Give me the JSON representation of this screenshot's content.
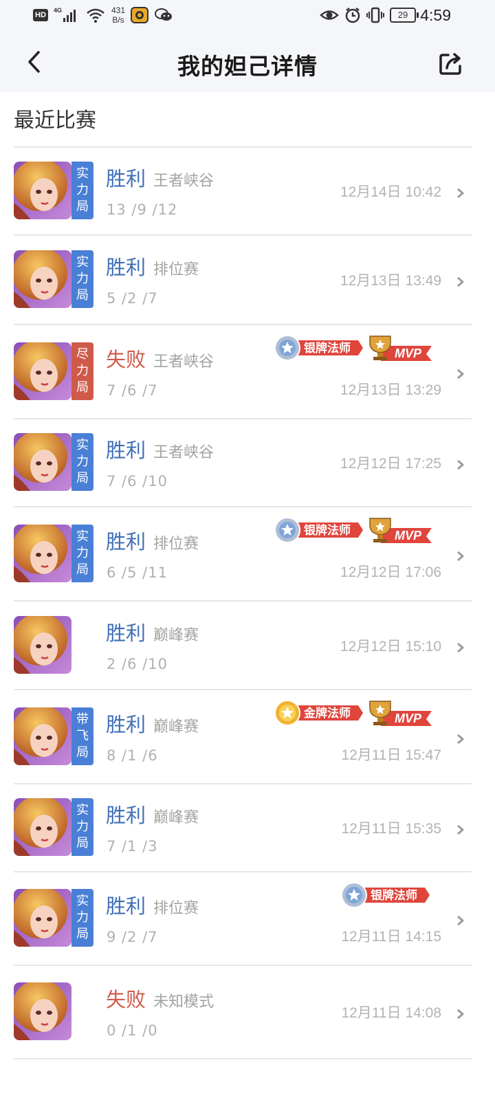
{
  "status_bar": {
    "hd": "HD",
    "network": "4G",
    "speed_value": "431",
    "speed_unit": "B/s",
    "battery": "29",
    "time": "4:59"
  },
  "header": {
    "title": "我的妲己详情"
  },
  "section_title": "最近比赛",
  "colors": {
    "win": "#3f6fb8",
    "lose": "#d05a4a",
    "tag_blue": "#4a7fd6",
    "tag_red": "#d05a4a",
    "badge_red": "#e0453c",
    "silver": "#aebfd6",
    "gold": "#f0b330"
  },
  "matches": [
    {
      "result": "胜利",
      "outcome": "win",
      "mode": "王者峡谷",
      "kda": "13 /9 /12",
      "date": "12月14日 10:42",
      "tag": [
        "实",
        "力",
        "局"
      ],
      "tag_color": "blue",
      "medal": null,
      "mvp": false
    },
    {
      "result": "胜利",
      "outcome": "win",
      "mode": "排位赛",
      "kda": "5 /2 /7",
      "date": "12月13日 13:49",
      "tag": [
        "实",
        "力",
        "局"
      ],
      "tag_color": "blue",
      "medal": null,
      "mvp": false
    },
    {
      "result": "失败",
      "outcome": "lose",
      "mode": "王者峡谷",
      "kda": "7 /6 /7",
      "date": "12月13日 13:29",
      "tag": [
        "尽",
        "力",
        "局"
      ],
      "tag_color": "red",
      "medal": {
        "label": "银牌法师",
        "type": "silver"
      },
      "mvp": true
    },
    {
      "result": "胜利",
      "outcome": "win",
      "mode": "王者峡谷",
      "kda": "7 /6 /10",
      "date": "12月12日 17:25",
      "tag": [
        "实",
        "力",
        "局"
      ],
      "tag_color": "blue",
      "medal": null,
      "mvp": false
    },
    {
      "result": "胜利",
      "outcome": "win",
      "mode": "排位赛",
      "kda": "6 /5 /11",
      "date": "12月12日 17:06",
      "tag": [
        "实",
        "力",
        "局"
      ],
      "tag_color": "blue",
      "medal": {
        "label": "银牌法师",
        "type": "silver"
      },
      "mvp": true
    },
    {
      "result": "胜利",
      "outcome": "win",
      "mode": "巅峰赛",
      "kda": "2 /6 /10",
      "date": "12月12日 15:10",
      "tag": null,
      "tag_color": null,
      "medal": null,
      "mvp": false
    },
    {
      "result": "胜利",
      "outcome": "win",
      "mode": "巅峰赛",
      "kda": "8 /1 /6",
      "date": "12月11日 15:47",
      "tag": [
        "带",
        "飞",
        "局"
      ],
      "tag_color": "blue",
      "medal": {
        "label": "金牌法师",
        "type": "gold"
      },
      "mvp": true
    },
    {
      "result": "胜利",
      "outcome": "win",
      "mode": "巅峰赛",
      "kda": "7 /1 /3",
      "date": "12月11日 15:35",
      "tag": [
        "实",
        "力",
        "局"
      ],
      "tag_color": "blue",
      "medal": null,
      "mvp": false
    },
    {
      "result": "胜利",
      "outcome": "win",
      "mode": "排位赛",
      "kda": "9 /2 /7",
      "date": "12月11日 14:15",
      "tag": [
        "实",
        "力",
        "局"
      ],
      "tag_color": "blue",
      "medal": {
        "label": "银牌法师",
        "type": "silver"
      },
      "mvp": false
    },
    {
      "result": "失败",
      "outcome": "lose",
      "mode": "未知模式",
      "kda": "0 /1 /0",
      "date": "12月11日 14:08",
      "tag": null,
      "tag_color": null,
      "medal": null,
      "mvp": false
    }
  ],
  "mvp_label": "MVP"
}
